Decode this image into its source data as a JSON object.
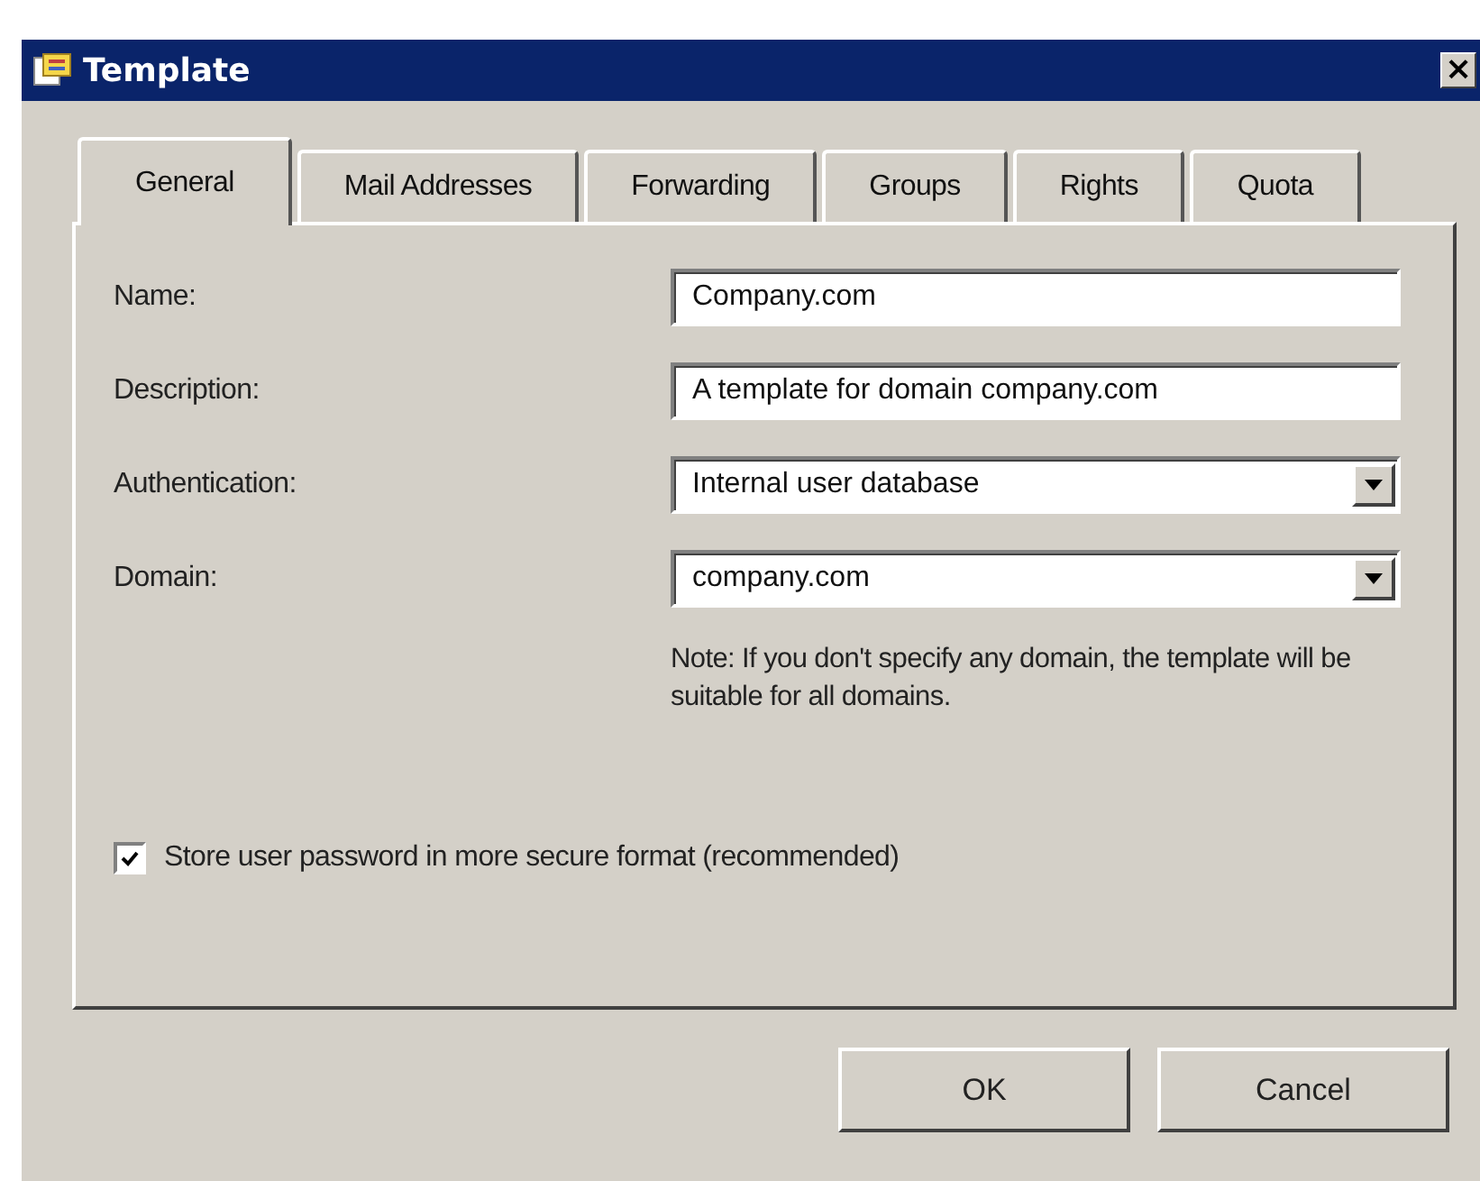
{
  "window": {
    "title": "Template",
    "close": "×"
  },
  "tabs": [
    {
      "label": "General",
      "selected": true
    },
    {
      "label": "Mail Addresses",
      "selected": false
    },
    {
      "label": "Forwarding",
      "selected": false
    },
    {
      "label": "Groups",
      "selected": false
    },
    {
      "label": "Rights",
      "selected": false
    },
    {
      "label": "Quota",
      "selected": false
    }
  ],
  "fields": [
    {
      "kind": "text",
      "label": "Name:",
      "value": "Company.com"
    },
    {
      "kind": "text",
      "label": "Description:",
      "value": "A template for domain company.com"
    },
    {
      "kind": "dropdown",
      "label": "Authentication:",
      "value": "Internal user database"
    },
    {
      "kind": "dropdown",
      "label": "Domain:",
      "value": "company.com"
    }
  ],
  "note": "Note: If you don't specify any domain, the template will be suitable for all domains.",
  "checkbox": {
    "label": "Store user password in more secure format (recommended)",
    "checked": true
  },
  "buttons": [
    "OK",
    "Cancel"
  ]
}
